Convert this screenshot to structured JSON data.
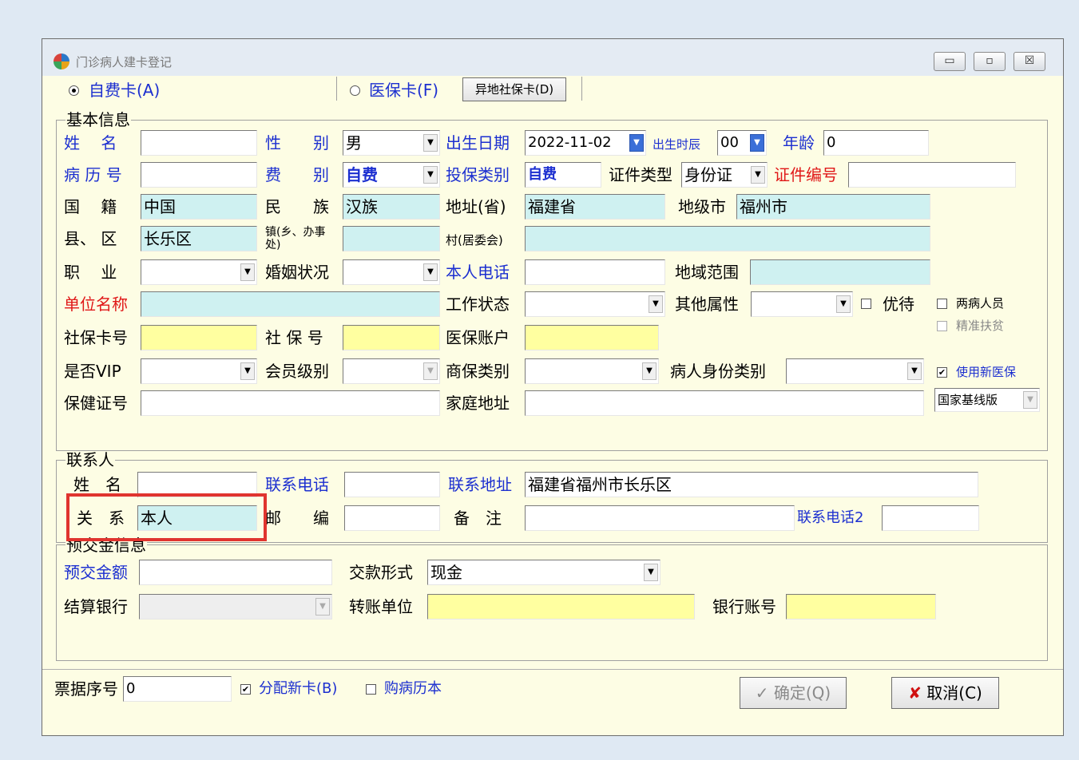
{
  "window": {
    "title": "门诊病人建卡登记"
  },
  "window_buttons": {
    "minimize": "▭",
    "restore": "▫",
    "close": "☒"
  },
  "tabs": {
    "self_pay": "自费卡(A)",
    "insurance": "医保卡(F)",
    "remote_button": "异地社保卡(D)"
  },
  "basic": {
    "group_label": "基本信息",
    "name_label": "姓　 名",
    "name_value": "",
    "gender_label": "性　　别",
    "gender_value": "男",
    "birth_label": "出生日期",
    "birth_value": "2022-11-02",
    "birth_hour_label": "出生时辰",
    "birth_hour_value": "00",
    "age_label": "年龄",
    "age_value": "0",
    "record_label": "病 历 号",
    "record_value": "",
    "fee_label": "费　　别",
    "fee_value": "自费",
    "ins_type_label": "投保类别",
    "ins_type_value": "自费",
    "id_type_label": "证件类型",
    "id_type_value": "身份证",
    "id_no_label": "证件编号",
    "id_no_value": "",
    "nation_label": "国　 籍",
    "nation_value": "中国",
    "ethnic_label": "民　　族",
    "ethnic_value": "汉族",
    "province_label": "地址(省)",
    "province_value": "福建省",
    "city_label": "地级市",
    "city_value": "福州市",
    "county_label": "县、 区",
    "county_value": "长乐区",
    "town_label": "镇(乡、办事处)",
    "town_value": "",
    "village_label": "村(居委会)",
    "village_value": "",
    "job_label": "职　 业",
    "job_value": "",
    "marital_label": "婚姻状况",
    "marital_value": "",
    "phone_label": "本人电话",
    "phone_value": "",
    "region_label": "地域范围",
    "region_value": "",
    "unit_label": "单位名称",
    "unit_value": "",
    "work_label": "工作状态",
    "work_value": "",
    "other_label": "其他属性",
    "other_value": "",
    "priority_label": "优待",
    "two_disease_label": "两病人员",
    "poverty_label": "精准扶贫",
    "sscard_label": "社保卡号",
    "sscard_value": "",
    "ssno_label": "社 保 号",
    "ssno_value": "",
    "medacct_label": "医保账户",
    "medacct_value": "",
    "vip_label": "是否VIP",
    "vip_value": "",
    "member_label": "会员级别",
    "member_value": "",
    "comm_ins_label": "商保类别",
    "comm_ins_value": "",
    "patient_type_label": "病人身份类别",
    "patient_type_value": "",
    "new_ins_label": "使用新医保",
    "health_label": "保健证号",
    "health_value": "",
    "home_label": "家庭地址",
    "home_value": "",
    "version_value": "国家基线版"
  },
  "contact": {
    "group_label": "联系人",
    "name_label": "姓　名",
    "name_value": "",
    "phone_label": "联系电话",
    "phone_value": "",
    "address_label": "联系地址",
    "address_value": "福建省福州市长乐区",
    "relation_label": "关　系",
    "relation_value": "本人",
    "zip_label": "邮　　编",
    "zip_value": "",
    "note_label": "备　注",
    "note_value": "",
    "phone2_label": "联系电话2",
    "phone2_value": ""
  },
  "deposit": {
    "group_label": "预交金信息",
    "amount_label": "预交金额",
    "amount_value": "",
    "method_label": "交款形式",
    "method_value": "现金",
    "bank_label": "结算银行",
    "bank_value": "",
    "transfer_label": "转账单位",
    "transfer_value": "",
    "account_label": "银行账号",
    "account_value": ""
  },
  "footer": {
    "receipt_label": "票据序号",
    "receipt_value": "0",
    "new_card_label": "分配新卡(B)",
    "buy_record_label": "购病历本",
    "confirm_label": "确定(Q)",
    "cancel_label": "取消(C)"
  }
}
